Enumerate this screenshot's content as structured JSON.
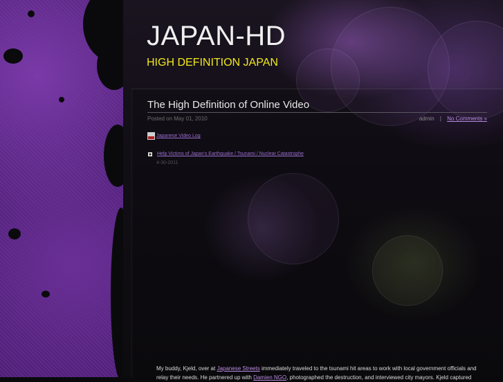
{
  "site": {
    "title": "JAPAN-HD",
    "tagline": "HIGH DEFINITION JAPAN"
  },
  "post": {
    "title": "The High Definition of Online Video",
    "posted_on": "Posted on May 01, 2010",
    "author": "admin",
    "separator": "|",
    "comments_link": "No Comments »"
  },
  "feed": {
    "icon": "rss-feed-icon",
    "link_text": "Japanese Video Log"
  },
  "news": {
    "bullet_icon": "arrow-bullet-icon",
    "link_text": "Help Victims of Japan's Earthquake / Tsunami / Nuclear Catastrophe",
    "date": "4-30-2011"
  },
  "body": {
    "p1_a": "My buddy, Kjeld, over at ",
    "p1_link1": "Japanese Streets",
    "p1_b": " immediately traveled to the tsunami hit areas to work with local government officials and relay their needs. He partnered up with ",
    "p1_link2": "Damien NGO",
    "p1_c": ", photographed the destruction, and interviewed city mayors. Kjeld captured"
  },
  "colors": {
    "accent_purple": "#9b6fd0",
    "tagline_yellow": "#f3e91c",
    "title_white": "#f0f0f0"
  }
}
